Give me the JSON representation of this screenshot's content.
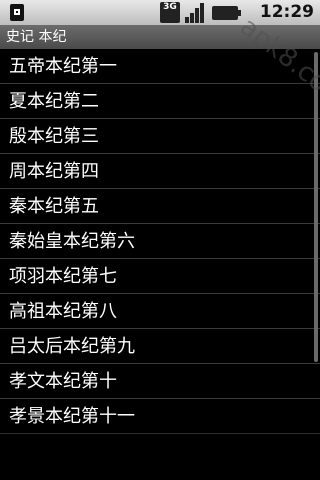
{
  "status_bar": {
    "network_label": "3G",
    "time": "12:29",
    "icons": [
      "sd-card-icon",
      "network-3g-icon",
      "signal-icon",
      "battery-icon"
    ]
  },
  "title_bar": {
    "title": "史记 本纪"
  },
  "chapters": [
    "五帝本纪第一",
    "夏本纪第二",
    "殷本纪第三",
    "周本纪第四",
    "秦本纪第五",
    "秦始皇本纪第六",
    "项羽本纪第七",
    "高祖本纪第八",
    "吕太后本纪第九",
    "孝文本纪第十",
    "孝景本纪第十一"
  ],
  "watermark": {
    "text": "apk8.com"
  }
}
